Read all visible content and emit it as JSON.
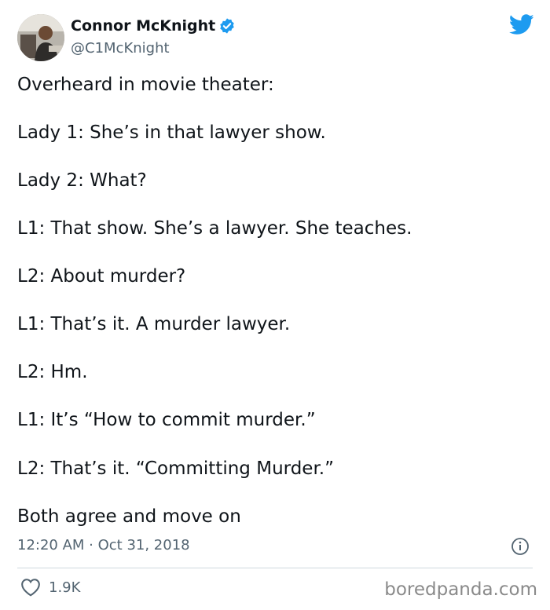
{
  "author": {
    "name": "Connor McKnight",
    "handle": "@C1McKnight",
    "avatar_icon": "profile-photo",
    "verified_icon": "verified-badge-icon"
  },
  "brand_icon": "twitter-bird-icon",
  "colors": {
    "twitter_blue": "#1d9bf0",
    "text": "#0f1419",
    "secondary_text": "#536471",
    "divider": "#cfd9de"
  },
  "tweet_lines": [
    "Overheard in movie theater:",
    "Lady 1: She’s in that lawyer show.",
    "Lady 2: What?",
    "L1: That show. She’s a lawyer. She teaches.",
    "L2: About murder?",
    "L1: That’s it. A murder lawyer.",
    "L2: Hm.",
    "L1: It’s “How to commit murder.”",
    "L2: That’s it. “Committing Murder.”",
    "Both agree and move on"
  ],
  "timestamp": "12:20 AM · Oct 31, 2018",
  "likes": "1.9K",
  "watermark": "boredpanda.com"
}
